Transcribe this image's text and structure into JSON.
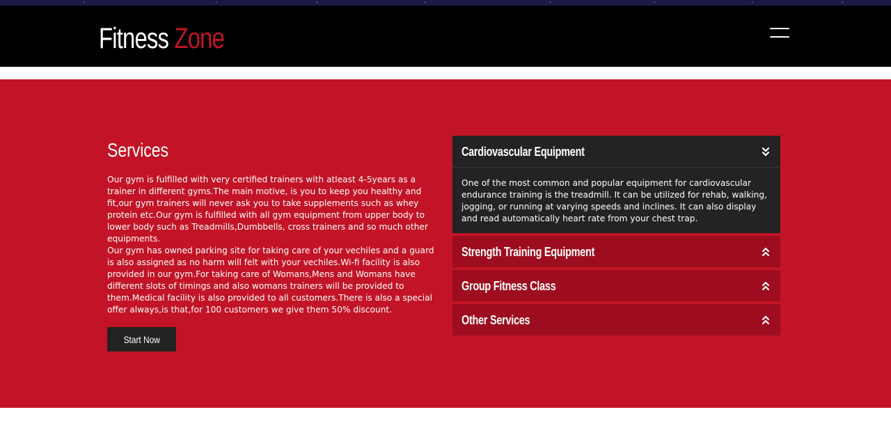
{
  "header": {
    "logo_main": "Fitness",
    "logo_accent": "Zone",
    "accent_color": "#c21426",
    "menu_icon": "hamburger-menu-icon"
  },
  "services": {
    "background_color": "#c21426",
    "title": "Services",
    "paragraphs": [
      "Our gym is fulfilled with very certified trainers with atleast 4-5years as a trainer in different gyms.The main motive, is you to keep you healthy and fit,our gym trainers will never ask you to take supplements such as whey protein etc.Our gym is fulfilled with all gym equipment from upper body to lower body such as Treadmills,Dumbbells, cross trainers and so much other equipments.",
      "Our gym has owned parking site for taking care of your vechiles and a guard is also assigned as no harm will felt with your vechiles.Wi-fi facility is also provided in our gym.For taking care of Womans,Mens and Womans have different slots of timings and also womans trainers will be provided to them.Medical facility is also provided to all customers.There is also a special offer always,is that,for 100 customers we give them 50% discount."
    ],
    "cta_label": "Start Now"
  },
  "accordion": {
    "items": [
      {
        "label": "Cardiovascular Equipment",
        "expanded": true,
        "icon": "chevron-double-down-icon",
        "body": "One of the most common and popular equipment for cardiovascular endurance training is the treadmill. It can be utilized for rehab, walking, jogging, or running at varying speeds and inclines. It can also display and read automatically heart rate from your chest trap."
      },
      {
        "label": "Strength Training Equipment",
        "expanded": false,
        "icon": "chevron-double-up-icon"
      },
      {
        "label": "Group Fitness Class",
        "expanded": false,
        "icon": "chevron-double-up-icon"
      },
      {
        "label": "Other Services",
        "expanded": false,
        "icon": "chevron-double-up-icon"
      }
    ],
    "open_color": "#232323",
    "closed_color": "#9e0d1f"
  }
}
